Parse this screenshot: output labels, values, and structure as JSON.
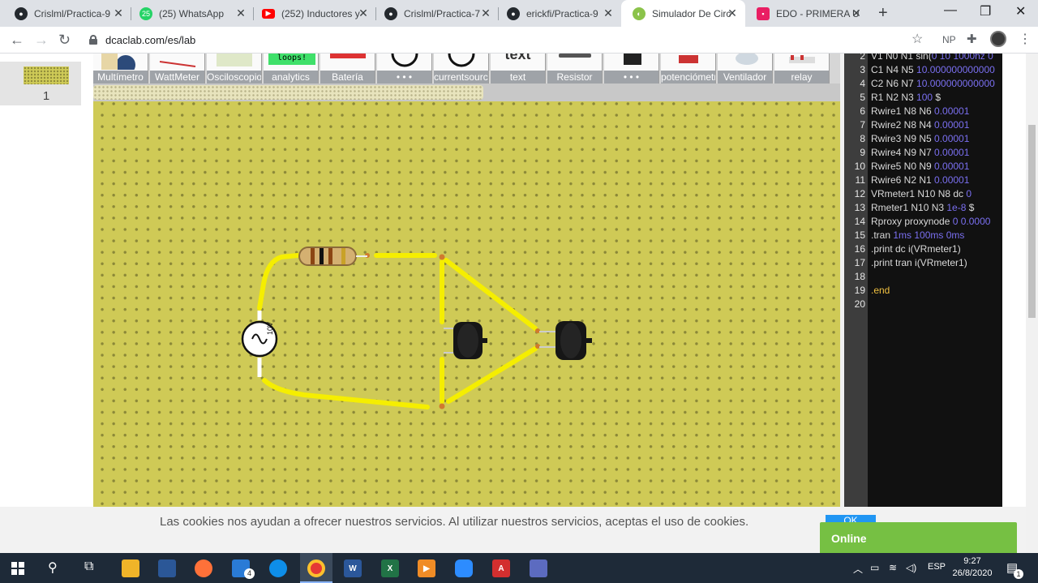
{
  "browser": {
    "tabs": [
      {
        "title": "Crislml/Practica-9",
        "icon": "github-icon",
        "color": "#24292e"
      },
      {
        "title": "(25) WhatsApp",
        "icon": "whatsapp-icon",
        "color": "#25d366",
        "badge": "25"
      },
      {
        "title": "(252) Inductores y",
        "icon": "youtube-icon",
        "color": "#ff0000"
      },
      {
        "title": "Crislml/Practica-7",
        "icon": "github-icon",
        "color": "#24292e"
      },
      {
        "title": "erickfi/Practica-9",
        "icon": "github-icon",
        "color": "#24292e"
      },
      {
        "title": "Simulador De Circ",
        "icon": "dcaclab-icon",
        "color": "#8bc34a",
        "active": true
      },
      {
        "title": "EDO - PRIMERA U",
        "icon": "classroom-icon",
        "color": "#e91e63"
      }
    ],
    "new_tab": "+",
    "url": "dcaclab.com/es/lab",
    "profile_initials": "NP"
  },
  "lab": {
    "page_number": "1",
    "palette": [
      "Multímetro",
      "WattMeter",
      "Osciloscopio",
      "analytics",
      "Batería",
      "• • •",
      "currentsource",
      "text",
      "Resistor",
      "• • •",
      "potenciómetro",
      "Ventilador",
      "relay"
    ],
    "analytics_sign": "loops!",
    "text_sign": "text",
    "source_label": "10V"
  },
  "netlist": [
    {
      "n": "2",
      "code": "V1 N0 N1 sin(0 10 1000hz 0"
    },
    {
      "n": "3",
      "code": "C1 N4 N5 10.000000000000"
    },
    {
      "n": "4",
      "code": "C2 N6 N7 10.000000000000"
    },
    {
      "n": "5",
      "code": "R1 N2 N3 100 $"
    },
    {
      "n": "6",
      "code": "Rwire1 N8 N6 0.00001"
    },
    {
      "n": "7",
      "code": "Rwire2 N8 N4 0.00001"
    },
    {
      "n": "8",
      "code": "Rwire3 N9 N5 0.00001"
    },
    {
      "n": "9",
      "code": "Rwire4 N9 N7 0.00001"
    },
    {
      "n": "10",
      "code": "Rwire5 N0 N9 0.00001"
    },
    {
      "n": "11",
      "code": "Rwire6 N2 N1 0.00001"
    },
    {
      "n": "12",
      "code": "VRmeter1 N10 N8 dc 0"
    },
    {
      "n": "13",
      "code": "Rmeter1 N10 N3 1e-8 $"
    },
    {
      "n": "14",
      "code": "Rproxy proxynode 0 0.0000"
    },
    {
      "n": "15",
      "code": ".tran 1ms 100ms 0ms"
    },
    {
      "n": "16",
      "code": ".print dc i(VRmeter1)"
    },
    {
      "n": "17",
      "code": ".print tran i(VRmeter1)"
    },
    {
      "n": "18",
      "code": ""
    },
    {
      "n": "19",
      "code": ".end"
    },
    {
      "n": "20",
      "code": ""
    }
  ],
  "cookie": {
    "message": "Las cookies nos ayudan a ofrecer nuestros servicios. Al utilizar nuestros servicios, aceptas el uso de cookies.",
    "ok": "OK"
  },
  "chat": {
    "status": "Online"
  },
  "taskbar": {
    "mail_badge": "4",
    "language": "ESP",
    "time": "9:27",
    "date": "26/8/2020",
    "notification_count": "1"
  },
  "colors": {
    "board": "#cfca56",
    "wire": "#f5ee00",
    "editor_bg": "#111111",
    "online": "#76c043"
  }
}
